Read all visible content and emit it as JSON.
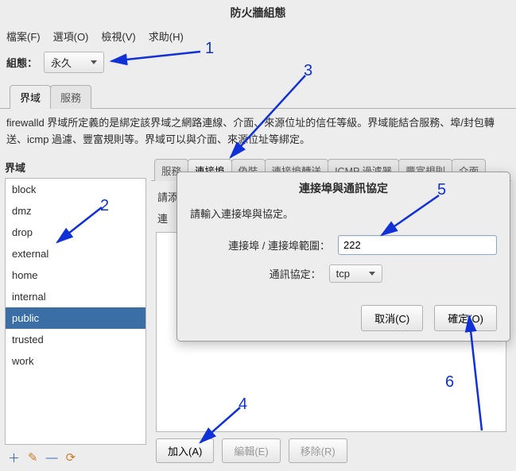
{
  "window_title": "防火牆組態",
  "menubar": {
    "file": "檔案(F)",
    "options": "選項(O)",
    "view": "檢視(V)",
    "help": "求助(H)"
  },
  "config": {
    "label": "組態：",
    "value": "永久"
  },
  "main_tabs": {
    "zones": "界域",
    "services": "服務"
  },
  "description": "firewalld 界域所定義的是綁定該界域之網路連線、介面、來源位址的信任等級。界域能結合服務、埠/封包轉送、icmp 過濾、豐富規則等。界域可以與介面、來源位址等綁定。",
  "zones": {
    "label": "界域",
    "items": [
      "block",
      "dmz",
      "drop",
      "external",
      "home",
      "internal",
      "public",
      "trusted",
      "work"
    ],
    "selected": "public"
  },
  "zone_toolbar": {
    "add": "＋",
    "edit": "✎",
    "remove": "—",
    "reload": "⟳"
  },
  "inner_tabs": {
    "services": "服務",
    "ports": "連接埠",
    "masq": "偽裝",
    "portfwd": "連接埠轉送",
    "icmp": "ICMP 過濾器",
    "rich": "豐富規則",
    "interfaces": "介面"
  },
  "ports_panel": {
    "hint_partial": "請添",
    "list_header": "連",
    "buttons": {
      "add": "加入(A)",
      "edit": "編輯(E)",
      "remove": "移除(R)"
    }
  },
  "dialog": {
    "title": "連接埠與通訊協定",
    "hint": "請輸入連接埠與協定。",
    "port_label": "連接埠 / 連接埠範圍：",
    "port_value": "222",
    "proto_label": "通訊協定：",
    "proto_value": "tcp",
    "cancel": "取消(C)",
    "ok": "確定(O)"
  },
  "annotations": {
    "n1": "1",
    "n2": "2",
    "n3": "3",
    "n4": "4",
    "n5": "5",
    "n6": "6"
  }
}
